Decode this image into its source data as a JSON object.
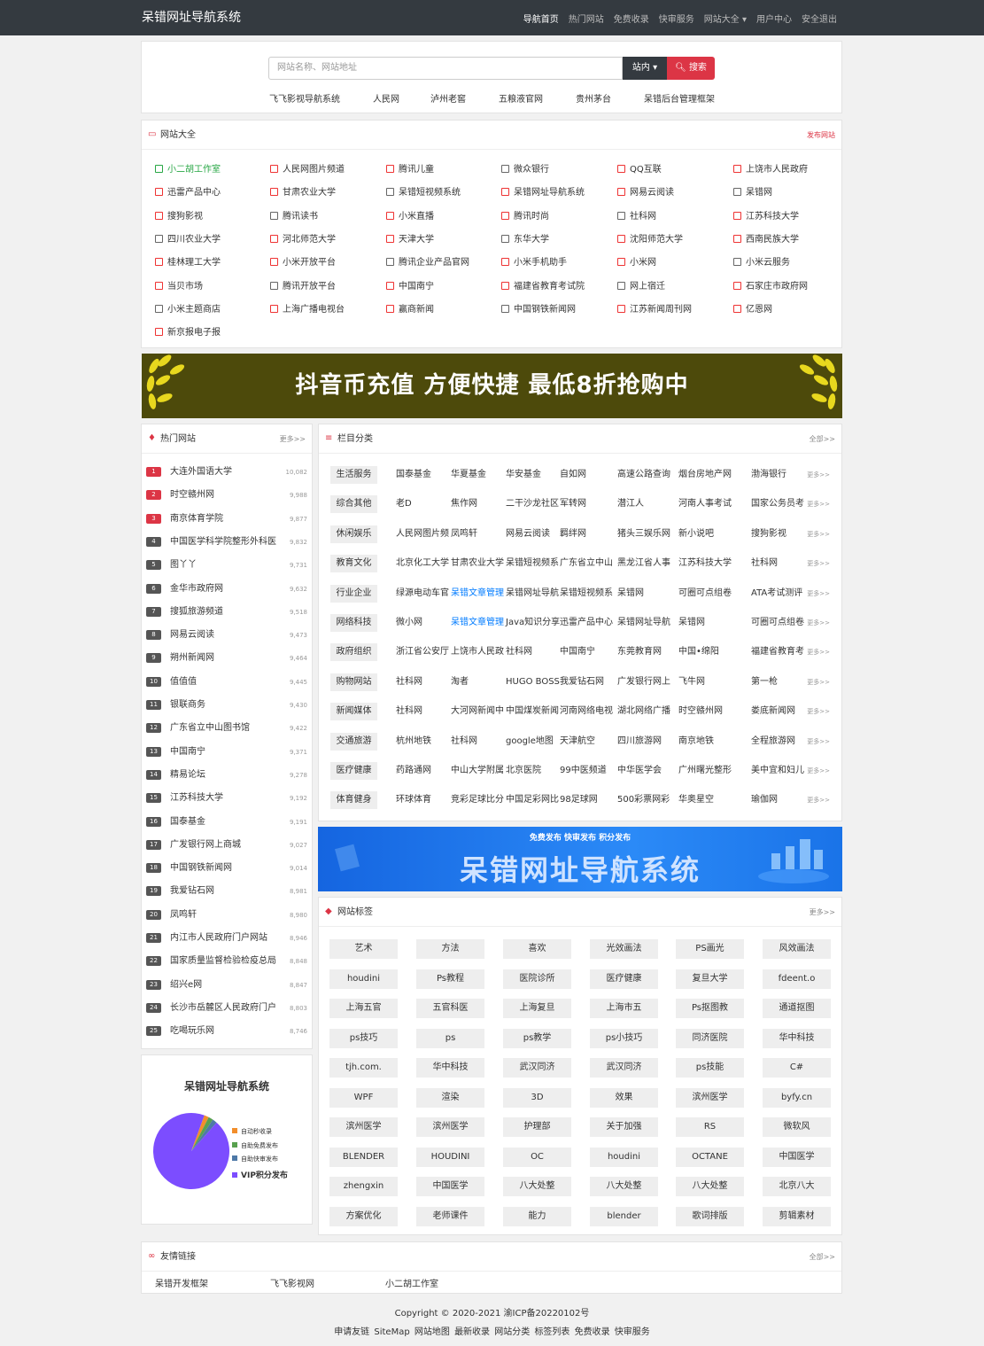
{
  "brand": "呆错网址导航系统",
  "nav": [
    "导航首页",
    "热门网站",
    "免费收录",
    "快审服务",
    "网站大全 ▾",
    "用户中心",
    "安全退出"
  ],
  "search": {
    "placeholder": "网站名称、网站地址",
    "scope": "站内 ▾",
    "button": "搜索"
  },
  "hot_keywords": [
    "飞飞影视导航系统",
    "人民网",
    "泸州老窖",
    "五粮液官网",
    "贵州茅台",
    "呆错后台管理框架"
  ],
  "site_card": {
    "title": "网站大全",
    "action": "发布网站"
  },
  "sites": [
    [
      "小二胡工作室",
      "人民网图片频道",
      "腾讯儿童",
      "微众银行",
      "QQ互联",
      "上饶市人民政府"
    ],
    [
      "迅雷产品中心",
      "甘肃农业大学",
      "呆错短视频系统",
      "呆错网址导航系统",
      "网易云阅读",
      "呆错网"
    ],
    [
      "搜狗影视",
      "腾讯读书",
      "小米直播",
      "腾讯时尚",
      "社科网",
      "江苏科技大学"
    ],
    [
      "四川农业大学",
      "河北师范大学",
      "天津大学",
      "东华大学",
      "沈阳师范大学",
      "西南民族大学"
    ],
    [
      "桂林理工大学",
      "小米开放平台",
      "腾讯企业产品官网",
      "小米手机助手",
      "小米网",
      "小米云服务"
    ],
    [
      "当贝市场",
      "腾讯开放平台",
      "中国南宁",
      "福建省教育考试院",
      "网上宿迁",
      "石家庄市政府网"
    ],
    [
      "小米主题商店",
      "上海广播电视台",
      "赢商新闻",
      "中国钢铁新闻网",
      "江苏新闻周刊网",
      "亿恩网"
    ],
    [
      "新京报电子报"
    ]
  ],
  "banner1": "抖音币充值 方便快捷 最低8折抢购中",
  "hot_card": {
    "title": "热门网站",
    "more": "更多>>"
  },
  "hot_sites": [
    {
      "name": "大连外国语大学",
      "count": "10,082"
    },
    {
      "name": "时空赣州网",
      "count": "9,988"
    },
    {
      "name": "南京体育学院",
      "count": "9,877"
    },
    {
      "name": "中国医学科学院整形外科医",
      "count": "9,832"
    },
    {
      "name": "图丫丫",
      "count": "9,731"
    },
    {
      "name": "金华市政府网",
      "count": "9,632"
    },
    {
      "name": "搜狐旅游频道",
      "count": "9,518"
    },
    {
      "name": "网易云阅读",
      "count": "9,473"
    },
    {
      "name": "朔州新闻网",
      "count": "9,464"
    },
    {
      "name": "值值值",
      "count": "9,445"
    },
    {
      "name": "银联商务",
      "count": "9,430"
    },
    {
      "name": "广东省立中山图书馆",
      "count": "9,422"
    },
    {
      "name": "中国南宁",
      "count": "9,371"
    },
    {
      "name": "精易论坛",
      "count": "9,278"
    },
    {
      "name": "江苏科技大学",
      "count": "9,192"
    },
    {
      "name": "国泰基金",
      "count": "9,191"
    },
    {
      "name": "广发银行网上商城",
      "count": "9,027"
    },
    {
      "name": "中国钢铁新闻网",
      "count": "9,014"
    },
    {
      "name": "我爱钻石网",
      "count": "8,981"
    },
    {
      "name": "凤鸣轩",
      "count": "8,980"
    },
    {
      "name": "内江市人民政府门户网站",
      "count": "8,946"
    },
    {
      "name": "国家质量监督检验检疫总局",
      "count": "8,848"
    },
    {
      "name": "绍兴e网",
      "count": "8,847"
    },
    {
      "name": "长沙市岳麓区人民政府门户",
      "count": "8,803"
    },
    {
      "name": "吃喝玩乐网",
      "count": "8,746"
    }
  ],
  "cat_card": {
    "title": "栏目分类",
    "more": "全部>>"
  },
  "categories": [
    {
      "name": "生活服务",
      "items": [
        "国泰基金",
        "华夏基金",
        "华安基金",
        "自如网",
        "高速公路查询",
        "烟台房地产网",
        "渤海银行"
      ]
    },
    {
      "name": "综合其他",
      "items": [
        "老D",
        "焦作网",
        "二干沙龙社区",
        "军转网",
        "潜江人",
        "河南人事考试",
        "国家公务员考"
      ]
    },
    {
      "name": "休闲娱乐",
      "items": [
        "人民网图片频",
        "凤鸣轩",
        "网易云阅读",
        "羁绊网",
        "猪头三娱乐网",
        "新小说吧",
        "搜狗影视"
      ]
    },
    {
      "name": "教育文化",
      "items": [
        "北京化工大学",
        "甘肃农业大学",
        "呆错短视频系",
        "广东省立中山",
        "黑龙江省人事",
        "江苏科技大学",
        "社科网"
      ]
    },
    {
      "name": "行业企业",
      "items": [
        "绿源电动车官",
        "呆错文章管理",
        "呆错网址导航",
        "呆错短视频系",
        "呆错网",
        "可圈可点组卷",
        "ATA考试测评"
      ]
    },
    {
      "name": "网络科技",
      "items": [
        "微小网",
        "呆错文章管理",
        "Java知识分享",
        "迅雷产品中心",
        "呆错网址导航",
        "呆错网",
        "可圈可点组卷"
      ]
    },
    {
      "name": "政府组织",
      "items": [
        "浙江省公安厅",
        "上饶市人民政",
        "社科网",
        "中国南宁",
        "东莞教育网",
        "中国•绵阳",
        "福建省教育考"
      ]
    },
    {
      "name": "购物网站",
      "items": [
        "社科网",
        "淘者",
        "HUGO BOSS",
        "我爱钻石网",
        "广发银行网上",
        "飞牛网",
        "第一枪"
      ]
    },
    {
      "name": "新闻媒体",
      "items": [
        "社科网",
        "大河网新闻中",
        "中国煤炭新闻",
        "河南网络电视",
        "湖北网络广播",
        "时空赣州网",
        "娄底新闻网"
      ]
    },
    {
      "name": "交通旅游",
      "items": [
        "杭州地铁",
        "社科网",
        "google地图",
        "天津航空",
        "四川旅游网",
        "南京地铁",
        "全程旅游网"
      ]
    },
    {
      "name": "医疗健康",
      "items": [
        "药路通网",
        "中山大学附属",
        "北京医院",
        "99中医频道",
        "中华医学会",
        "广州曙光整形",
        "美中宜和妇儿"
      ]
    },
    {
      "name": "体育健身",
      "items": [
        "环球体育",
        "竞彩足球比分",
        "中国足彩网比",
        "98足球网",
        "500彩票网彩",
        "华奥星空",
        "瑜伽网"
      ]
    }
  ],
  "cat_more": "更多>>",
  "banner2": {
    "top": "免费发布 快审发布 积分发布",
    "main": "呆错网址导航系统"
  },
  "tag_card": {
    "title": "网站标签",
    "more": "更多>>"
  },
  "tags": [
    "艺术",
    "方法",
    "喜欢",
    "光效画法",
    "PS画光",
    "风效画法",
    "houdini",
    "Ps教程",
    "医院诊所",
    "医疗健康",
    "复旦大学",
    "fdeent.o",
    "上海五官",
    "五官科医",
    "上海复旦",
    "上海市五",
    "Ps抠图教",
    "通道抠图",
    "ps技巧",
    "ps",
    "ps教学",
    "ps小技巧",
    "同济医院",
    "华中科技",
    "tjh.com.",
    "华中科技",
    "武汉同济",
    "武汉同济",
    "ps技能",
    "C#",
    "WPF",
    "渲染",
    "3D",
    "效果",
    "滨州医学",
    "byfy.cn",
    "滨州医学",
    "滨州医学",
    "护理部",
    "关于加强",
    "RS",
    "微软风",
    "BLENDER",
    "HOUDINI",
    "OC",
    "houdini",
    "OCTANE",
    "中国医学",
    "zhengxin",
    "中国医学",
    "八大处整",
    "八大处整",
    "八大处整",
    "北京八大",
    "方案优化",
    "老师课件",
    "能力",
    "blender",
    "歌词排版",
    "剪辑素材"
  ],
  "pie": {
    "title": "呆错网址导航系统",
    "chart_data": {
      "type": "pie",
      "labels": [
        "自动秒收录",
        "自助免费发布",
        "自助快审发布",
        "VIP积分发布"
      ],
      "values": [
        2,
        2,
        2,
        94
      ],
      "colors": [
        "#f28e2b",
        "#59a14f",
        "#4e79a7",
        "#7c4dff"
      ]
    }
  },
  "friend_card": {
    "title": "友情链接",
    "more": "全部>>"
  },
  "friends": [
    "呆错开发框架",
    "飞飞影视网",
    "小二胡工作室"
  ],
  "footer": {
    "copyright": "Copyright © 2020-2021 渝ICP备20220102号",
    "links": [
      "申请友链",
      "SiteMap",
      "网站地图",
      "最新收录",
      "网站分类",
      "标签列表",
      "免费收录",
      "快审服务"
    ]
  }
}
